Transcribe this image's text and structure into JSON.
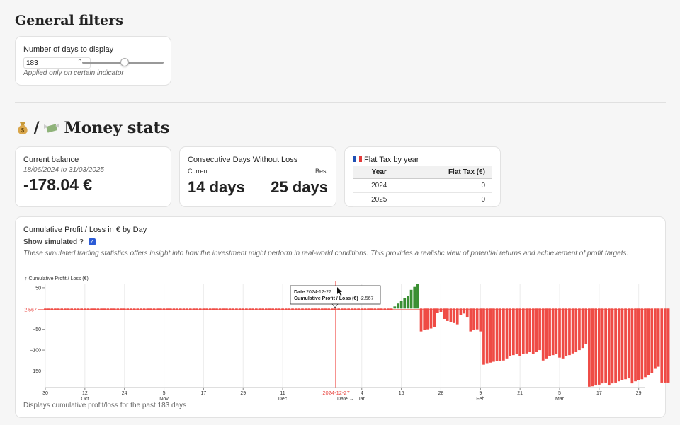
{
  "general_filters": {
    "title": "General filters",
    "days_label": "Number of days to display",
    "days_value": "183",
    "slider_fraction": 0.52,
    "note": "Applied only on certain indicator"
  },
  "money_stats": {
    "title": "Money stats",
    "separator": "/"
  },
  "balance": {
    "title": "Current balance",
    "range": "18/06/2024 to 31/03/2025",
    "value": "-178.04 €"
  },
  "streak": {
    "title": "Consecutive Days Without Loss",
    "current_label": "Current",
    "best_label": "Best",
    "current_value": "14 days",
    "best_value": "25 days"
  },
  "flat_tax": {
    "title": "Flat Tax by year",
    "columns": [
      "Year",
      "Flat Tax (€)"
    ],
    "rows": [
      [
        "2024",
        "0"
      ],
      [
        "2025",
        "0"
      ]
    ]
  },
  "pnl": {
    "title": "Cumulative Profit / Loss in € by Day",
    "show_simulated_label": "Show simulated ?",
    "show_simulated": true,
    "description": "These simulated trading statistics offers insight into how the investment might perform in real-world conditions. This provides a realistic view of potential returns and achievement of profit targets.",
    "footer": "Displays cumulative profit/loss for the past 183 days",
    "tooltip": {
      "date_label": "Date",
      "date_value": "2024-12-27",
      "value_label": "Cumulative Profit / Loss (€)",
      "value_value": "-2.567"
    }
  },
  "chart_data": {
    "type": "bar",
    "ylabel": "↑ Cumulative Profit / Loss (€)",
    "xlabel": "Date →",
    "ylim": [
      -190,
      60
    ],
    "yticks": [
      50,
      -50,
      -100,
      -150
    ],
    "ytick_labels": [
      "50",
      "−50",
      "−100",
      "−150"
    ],
    "rule_value": -2.567,
    "rule_label": "-2.567",
    "highlight_date": "2024-12-27",
    "highlight_label": "2024-12-27",
    "x_ticks": [
      {
        "day": 0,
        "label": "30",
        "month": ""
      },
      {
        "day": 12,
        "label": "12",
        "month": "Oct"
      },
      {
        "day": 24,
        "label": "24",
        "month": ""
      },
      {
        "day": 36,
        "label": "5",
        "month": "Nov"
      },
      {
        "day": 48,
        "label": "17",
        "month": ""
      },
      {
        "day": 60,
        "label": "29",
        "month": ""
      },
      {
        "day": 72,
        "label": "11",
        "month": "Dec"
      },
      {
        "day": 96,
        "label": "4",
        "month": "Jan"
      },
      {
        "day": 108,
        "label": "16",
        "month": ""
      },
      {
        "day": 120,
        "label": "28",
        "month": ""
      },
      {
        "day": 132,
        "label": "9",
        "month": "Feb"
      },
      {
        "day": 144,
        "label": "21",
        "month": ""
      },
      {
        "day": 156,
        "label": "5",
        "month": "Mar"
      },
      {
        "day": 168,
        "label": "17",
        "month": ""
      },
      {
        "day": 180,
        "label": "29",
        "month": ""
      }
    ],
    "days": 183,
    "start_date": "2024-09-30",
    "series": [
      {
        "values": [
          -2.567,
          -2.567,
          -2.567,
          -2.567,
          -2.567,
          -2.567,
          -2.567,
          -2.567,
          -2.567,
          -2.567,
          -2.567,
          -2.567,
          -2.567,
          -2.567,
          -2.567,
          -2.567,
          -2.567,
          -2.567,
          -2.567,
          -2.567,
          -2.567,
          -2.567,
          -2.567,
          -2.567,
          -2.567,
          -2.567,
          -2.567,
          -2.567,
          -2.567,
          -2.567,
          -2.567,
          -2.567,
          -2.567,
          -2.567,
          -2.567,
          -2.567,
          -2.567,
          -2.567,
          -2.567,
          -2.567,
          -2.567,
          -2.567,
          -2.567,
          -2.567,
          -2.567,
          -2.567,
          -2.567,
          -2.567,
          -2.567,
          -2.567,
          -2.567,
          -2.567,
          -2.567,
          -2.567,
          -2.567,
          -2.567,
          -2.567,
          -2.567,
          -2.567,
          -2.567,
          -2.567,
          -2.567,
          -2.567,
          -2.567,
          -2.567,
          -2.567,
          -2.567,
          -2.567,
          -2.567,
          -2.567,
          -2.567,
          -2.567,
          -2.567,
          -2.567,
          -2.567,
          -2.567,
          -2.567,
          -2.567,
          -2.567,
          -2.567,
          -2.567,
          -2.567,
          -2.567,
          -2.567,
          -2.567,
          -2.567,
          -2.567,
          -2.567,
          -2.567,
          -2.567,
          -2.567,
          -2.567,
          -2.567,
          -2.567,
          -2.567,
          -2.567,
          -2.567,
          -2.567,
          -2.567,
          -2.567,
          -2.567,
          -2.567,
          -2.567,
          -2.567,
          -2.567,
          -2.567,
          5,
          12,
          18,
          25,
          30,
          45,
          52,
          60,
          -55,
          -52,
          -50,
          -48,
          -45,
          -10,
          -8,
          -25,
          -30,
          -32,
          -35,
          -38,
          -15,
          -12,
          -20,
          -55,
          -52,
          -50,
          -55,
          -135,
          -133,
          -130,
          -128,
          -127,
          -126,
          -125,
          -120,
          -115,
          -112,
          -110,
          -115,
          -110,
          -108,
          -105,
          -110,
          -105,
          -100,
          -125,
          -120,
          -115,
          -112,
          -110,
          -118,
          -120,
          -115,
          -112,
          -108,
          -105,
          -100,
          -95,
          -85,
          -188,
          -187,
          -185,
          -183,
          -180,
          -178,
          -185,
          -180,
          -178,
          -175,
          -172,
          -170,
          -168,
          -180,
          -175,
          -172,
          -170,
          -165,
          -160,
          -155,
          -145,
          -140,
          -178,
          -178,
          -178
        ]
      }
    ]
  }
}
